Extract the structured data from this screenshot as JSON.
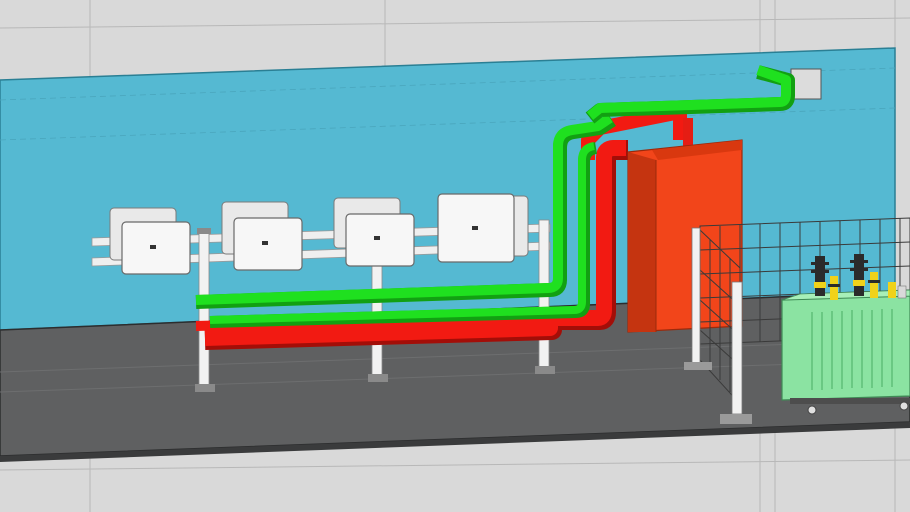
{
  "scene": {
    "colors": {
      "background": "#d9d9d9",
      "wall": "#55b9d2",
      "wall_edge": "#2a7f94",
      "floor": "#5f6061",
      "floor_edge": "#2c2d2e",
      "pipe_green": "#1fe01f",
      "pipe_green_dark": "#12a012",
      "pipe_red": "#f21a12",
      "pipe_red_dark": "#a30e08",
      "cabinet": "#f2451a",
      "cabinet_dark": "#c53410",
      "inverter": "#f5f5f5",
      "rack": "#ededed",
      "fence": "#3a3a3a",
      "transformer": "#8be3a2",
      "bushing": "#2b2b2b",
      "bushing_ring": "#f0d21a"
    }
  }
}
